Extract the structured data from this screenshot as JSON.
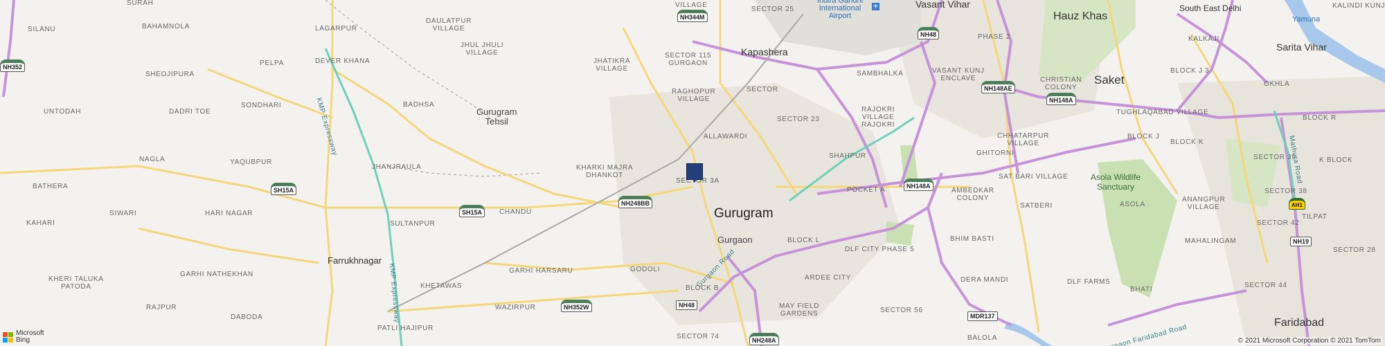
{
  "labels": {
    "surah": "SURAH",
    "silanu": "SILANU",
    "bahamnola": "BAHAMNOLA",
    "lagarpur": "LAGARPUR",
    "daulatpur": "DAULATPUR\nVILLAGE",
    "village_top": "VILLAGE",
    "sector25": "SECTOR 25",
    "airport": "Indira Gandhi\nInternational\nAirport",
    "vasant_vihar": "Vasant Vihar",
    "hauz_khas": "Hauz Khas",
    "south_east_delhi": "South East Delhi",
    "kalindi_kunj": "KALINDI KUNJ",
    "yamuna": "Yamuna",
    "jhul_jhuli": "JHUL JHULI\nVILLAGE",
    "pelpa": "PELPA",
    "dever_khana": "DEVER KHANA",
    "sector115": "SECTOR 115\nGURGAON",
    "kapashera": "Kapashera",
    "phase2": "PHASE 2",
    "kalkaji": "KALKAJI",
    "sarita_vihar": "Sarita Vihar",
    "sheojipura": "SHEOJIPURA",
    "jhatikra": "JHATIKRA\nVILLAGE",
    "sambhalka": "SAMBHALKA",
    "vasant_kunj": "VASANT KUNJ\nENCLAVE",
    "christian": "CHRISTIAN\nCOLONY",
    "saket": "Saket",
    "block_j3": "BLOCK J 3",
    "okhla": "OKHLA",
    "raghopur": "RAGHOPUR\nVILLAGE",
    "sector_mid": "SECTOR",
    "untodah": "UNTODAH",
    "sondhari": "SONDHARI",
    "badhsa": "BADHSA",
    "gurugram_tehsil": "Gurugram\nTehsil",
    "dadri_toe": "DADRI TOE",
    "sector23": "SECTOR 23",
    "rajokri": "RAJOKRI\nVILLAGE\nRAJOKRI",
    "tughlaqabad": "TUGHLAQABAD VILLAGE",
    "block_r": "BLOCK R",
    "allawardi": "ALLAWARDI",
    "chhatarpur": "CHHATARPUR\nVILLAGE",
    "block_j": "BLOCK J",
    "block_k": "BLOCK K",
    "nagla": "NAGLA",
    "yaqubpur": "YAQUBPUR",
    "jhanjraula": "JHANJRAULA",
    "kharki_majra": "KHARKI MAJRA\nDHANKOT",
    "shahpur": "SHAHPUR",
    "ghitorni": "GHITORNI",
    "sector39": "SECTOR 39",
    "block_q": "K BLOCK",
    "bathera": "BATHERA",
    "sector3a": "SECTOR 3A",
    "pocket_a": "POCKET A",
    "sat_bari": "SAT BARI VILLAGE",
    "asola_sanctuary": "Asola Wildlife\nSanctuary",
    "sector38": "SECTOR 38",
    "siwari": "SIWARI",
    "hari_nagar": "HARI NAGAR",
    "chandu": "CHANDU",
    "gurugram": "Gurugram",
    "ambedkar": "AMBEDKAR\nCOLONY",
    "satberi": "SATBERI",
    "asola": "ASOLA",
    "anangpur": "ANANGPUR\nVILLAGE",
    "kahari": "KAHARI",
    "sultanpur": "SULTANPUR",
    "gurgaon": "Gurgaon",
    "block_l": "BLOCK L",
    "bhim_basti": "BHIM BASTI",
    "sector42": "SECTOR 42",
    "tilpat": "TILPAT",
    "mahalingam": "MAHALINGAM",
    "farrukhnagar": "Farrukhnagar",
    "dlf_city": "DLF CITY PHASE 5",
    "sector28": "SECTOR 28",
    "garhi_harsaru": "GARHI HARSARU",
    "garhi_nathekhan": "GARHI NATHEKHAN",
    "kheri_taluka": "KHERI TALUKA\nPATODA",
    "khetawas": "KHETAWAS",
    "godoli": "GODOLI",
    "ardee": "ARDEE CITY",
    "dera_mandi": "DERA MANDI",
    "dlf_farms": "DLF FARMS",
    "bhati": "BHATI",
    "sector44": "SECTOR 44",
    "block_b": "BLOCK B",
    "rajpur": "RAJPUR",
    "dabuda": "DABODA",
    "wazirpur": "WAZIRPUR",
    "mayfield": "MAY FIELD\nGARDENS",
    "sector56": "SECTOR 56",
    "faridabad": "Faridabad",
    "patli_hajipur": "PATLI HAJIPUR",
    "sector74": "SECTOR 74",
    "baloda": "BALOLA"
  },
  "roads": {
    "kmp1": "KMP Expressway",
    "kmp2": "KMP Expressway",
    "gurgaon_road": "Gurgaon Road",
    "mathura_road": "Mathura Road",
    "faridabad_road": "Gurgaon Faridabad Road"
  },
  "shields": {
    "nh352": "NH352",
    "nh344m": "NH344M",
    "nh48a": "NH48",
    "nh148ae": "NH148AE",
    "nh148a_top": "NH148A",
    "sh15a_1": "SH15A",
    "sh15a_2": "SH15A",
    "nh248bb": "NH248BB",
    "nh148a_mid": "NH148A",
    "ah1": "AH1",
    "nh19": "NH19",
    "nh352w": "NH352W",
    "nh48b": "NH48",
    "mdr137": "MDR137",
    "nh248a": "NH248A"
  },
  "attribution": {
    "logo_line1": "Microsoft",
    "logo_line2": "Bing",
    "copyright": "© 2021 Microsoft Corporation © 2021 TomTom"
  },
  "colors": {
    "land": "#f3f2ef",
    "yellow_road": "#f3d77a",
    "purple_road": "#c693d8",
    "teal_expressway": "#6fcfba",
    "park": "#c4deb0",
    "urban": "#e6e3dc",
    "water": "#a7c7eb",
    "pin": "#233f7c"
  }
}
